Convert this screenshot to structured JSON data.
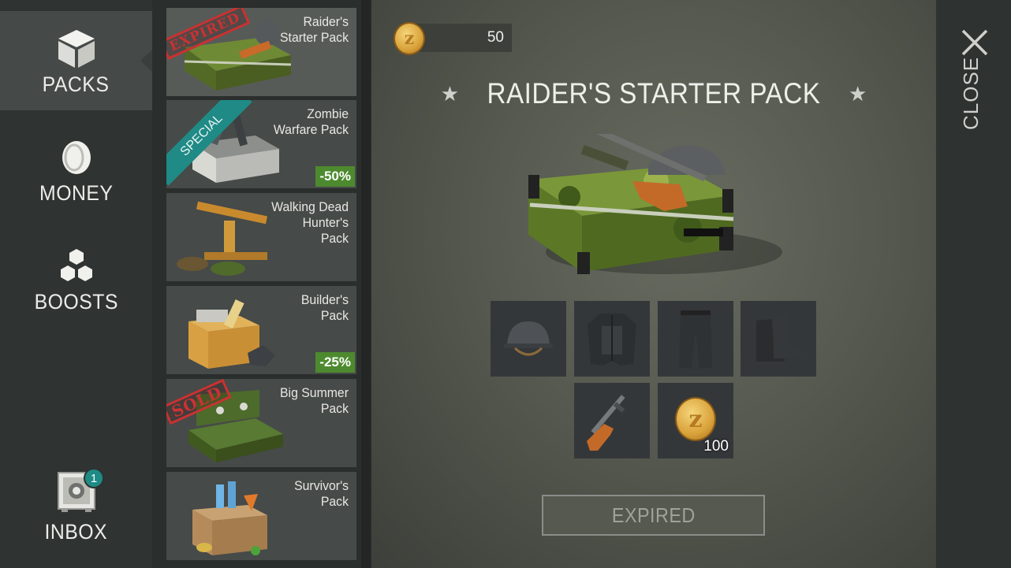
{
  "nav": {
    "items": [
      {
        "label": "PACKS",
        "icon": "cube-icon",
        "active": true
      },
      {
        "label": "MONEY",
        "icon": "coin-icon",
        "active": false
      },
      {
        "label": "BOOSTS",
        "icon": "hexagons-icon",
        "active": false
      },
      {
        "label": "INBOX",
        "icon": "safe-icon",
        "active": false,
        "badge": "1"
      }
    ]
  },
  "packs": [
    {
      "name_lines": [
        "Raider's",
        "Starter Pack"
      ],
      "stamp": "EXPIRED",
      "selected": true
    },
    {
      "name_lines": [
        "Zombie",
        "Warfare Pack"
      ],
      "ribbon": "SPECIAL",
      "discount": "-50%"
    },
    {
      "name_lines": [
        "Walking Dead",
        "Hunter's",
        "Pack"
      ]
    },
    {
      "name_lines": [
        "Builder's",
        "Pack"
      ],
      "discount": "-25%"
    },
    {
      "name_lines": [
        "Big Summer",
        "Pack"
      ],
      "stamp": "SOLD"
    },
    {
      "name_lines": [
        "Survivor's",
        "Pack"
      ]
    }
  ],
  "currency": {
    "amount": "50",
    "icon": "z-coin-icon"
  },
  "detail": {
    "title": "RAIDER'S STARTER PACK",
    "contents": [
      {
        "item": "helmet-icon"
      },
      {
        "item": "jacket-icon"
      },
      {
        "item": "pants-icon"
      },
      {
        "item": "boots-icon"
      },
      {
        "item": "rifle-icon"
      },
      {
        "item": "z-coin-icon",
        "qty": "100"
      }
    ],
    "button_label": "EXPIRED"
  },
  "close": {
    "label": "CLOSE"
  },
  "colors": {
    "accent_teal": "#1e8b86",
    "discount_green": "#4d8a2f",
    "stamp_red": "#c93232"
  }
}
